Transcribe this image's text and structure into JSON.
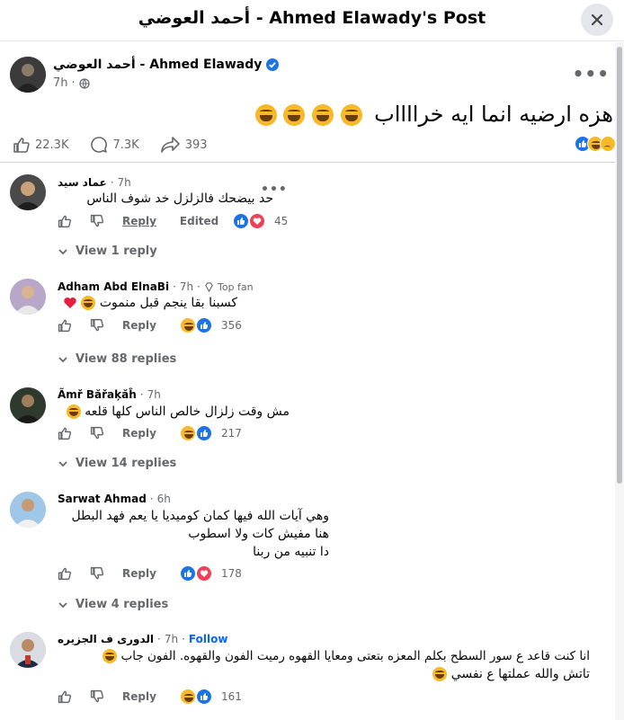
{
  "header": {
    "title": "أحمد العوضي - Ahmed Elawady's Post"
  },
  "post": {
    "author": "أحمد العوضي - Ahmed Elawady",
    "time": "7h",
    "text": "هزه ارضيه انما ايه خرااااب",
    "likes": "22.3K",
    "comments": "7.3K",
    "shares": "393"
  },
  "comments": [
    {
      "name": "عماد سيد",
      "time": "7h",
      "badge": "",
      "text": [
        "حد بيضحك فالزلزل خد شوف الناس"
      ],
      "reply": "Reply",
      "edited": "Edited",
      "reactions": "45",
      "view_replies": "View 1 reply"
    },
    {
      "name": "Adham Abd ElnaBi",
      "time": "7h",
      "badge": "Top fan",
      "text": [
        "كسبنا بقا ينجم قبل منموت"
      ],
      "reply": "Reply",
      "reactions": "356",
      "view_replies": "View 88 replies"
    },
    {
      "name": "Ãmř Băřaķăĥ",
      "time": "7h",
      "badge": "",
      "text": [
        "مش وقت زلزال خالص الناس كلها قلعه"
      ],
      "reply": "Reply",
      "reactions": "217",
      "view_replies": "View 14 replies"
    },
    {
      "name": "Sarwat Ahmad",
      "time": "6h",
      "badge": "",
      "text": [
        "وهي آيات الله فيها كمان كوميديا يا يعم فهد البطل",
        "هنا مفيش كات ولا اسطوب",
        "دا تنبيه من ربنا"
      ],
      "reply": "Reply",
      "reactions": "178",
      "view_replies": "View 4 replies"
    },
    {
      "name": "الدورى ف الجزيره",
      "time": "7h",
      "follow": "Follow",
      "text": [
        "انا كنت قاعد ع سور السطح بكلم المعزه بتعتى ومعايا القهوه رميت الفون والقهوه. الفون جاب",
        "تاتش والله عملتها ع نفسي"
      ],
      "reply": "Reply",
      "reactions": "161"
    }
  ]
}
